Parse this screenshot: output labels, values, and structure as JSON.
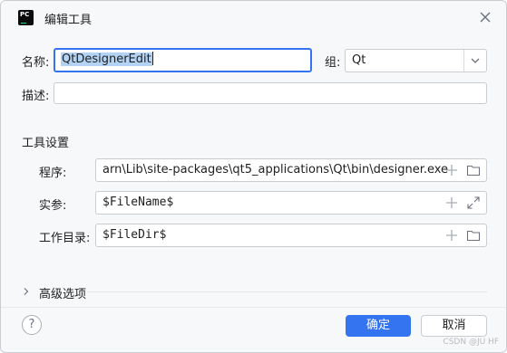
{
  "dialog": {
    "title": "编辑工具",
    "app_icon_text": "PC"
  },
  "form": {
    "name_label": "名称:",
    "name_value": "QtDesignerEdit",
    "group_label": "组:",
    "group_value": "Qt",
    "description_label": "描述:",
    "description_value": ""
  },
  "tool_settings": {
    "heading": "工具设置",
    "program_label": "程序:",
    "program_value": "arn\\Lib\\site-packages\\qt5_applications\\Qt\\bin\\designer.exe",
    "args_label": "实参:",
    "args_value": "$FileName$",
    "workdir_label": "工作目录:",
    "workdir_value": "$FileDir$"
  },
  "advanced": {
    "label": "高级选项"
  },
  "footer": {
    "help_label": "?",
    "ok_label": "确定",
    "cancel_label": "取消"
  },
  "watermark": "CSDN @JU HF",
  "colors": {
    "accent": "#3574f0",
    "selection": "#b3d3f5",
    "border": "#c9ccd1",
    "background": "#f7f8fa"
  },
  "icons": {
    "close": "close-icon",
    "chevron_down": "chevron-down-icon",
    "chevron_right": "chevron-right-icon",
    "add": "plus-icon",
    "folder": "folder-icon",
    "expand": "expand-icon",
    "help": "help-icon"
  }
}
